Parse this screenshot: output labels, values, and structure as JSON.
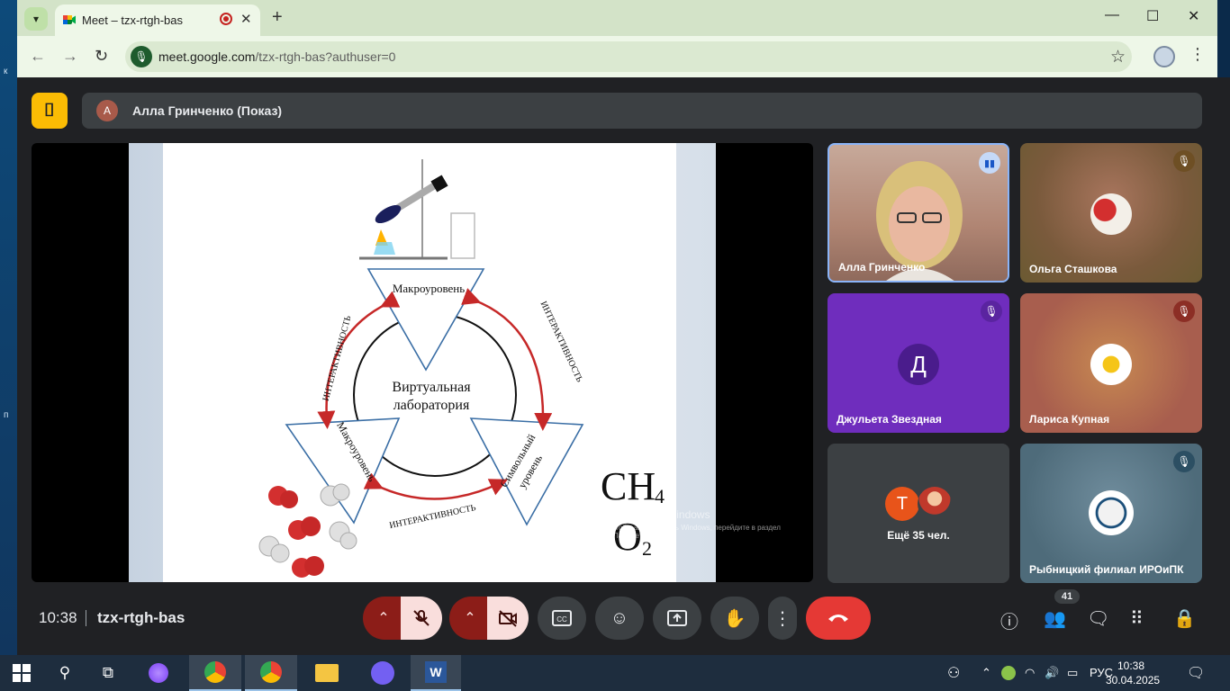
{
  "browser": {
    "tab_title": "Meet – tzx-rtgh-bas",
    "url_main": "meet.google.com",
    "url_rest": "/tzx-rtgh-bas?authuser=0"
  },
  "meet": {
    "presenter_initial": "А",
    "presenter_label": "Алла Гринченко (Показ)",
    "time": "10:38",
    "meeting_code": "tzx-rtgh-bas",
    "participant_count": "41",
    "colors": {
      "end_call": "#e53935",
      "mic_off_bg": "#f9dedc",
      "room_badge": "#fbbc04"
    }
  },
  "participants": [
    {
      "name": "Алла Гринченко",
      "state": "speaking"
    },
    {
      "name": "Ольга Сташкова",
      "state": "muted"
    },
    {
      "name": "Джульета Звездная",
      "initial": "Д",
      "state": "muted"
    },
    {
      "name": "Лариса Купная",
      "state": "muted"
    },
    {
      "name": "Ещё 35 чел.",
      "initial": "T"
    },
    {
      "name": "Рыбницкий филиал ИРОиПК",
      "state": "muted"
    }
  ],
  "slide": {
    "top_label": "Макроуровень",
    "left_label": "Макроуровень",
    "right_label_1": "Символьный",
    "right_label_2": "уровень",
    "center_1": "Виртуальная",
    "center_2": "лаборатория",
    "arc_label": "ИНТЕРАКТИВНОСТЬ",
    "formula_1": "CH",
    "formula_1_sub": "4",
    "formula_2": "O",
    "formula_2_sub": "2"
  },
  "watermark": {
    "title": "Активация Windows",
    "subtitle": "Чтобы активировать Windows, перейдите в раздел \"Параметры\"."
  },
  "taskbar": {
    "lang": "РУС",
    "time": "10:38",
    "date": "30.04.2025",
    "word_letter": "W"
  }
}
